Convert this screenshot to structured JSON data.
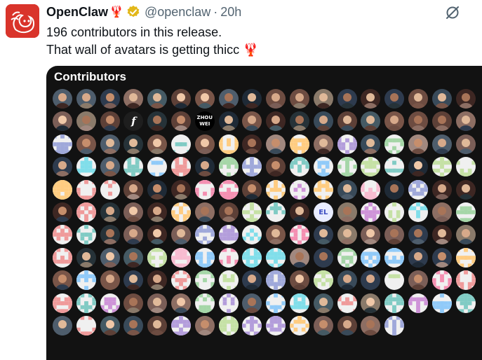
{
  "tweet": {
    "author_name": "OpenClaw",
    "author_emoji": "🦞",
    "handle": "@openclaw",
    "separator": "·",
    "time": "20h",
    "line1": "196 contributors in this release.",
    "line2": "That wall of avatars is getting thicc",
    "line2_emoji": "🦞"
  },
  "media": {
    "title": "Contributors",
    "avatar_texts": [
      "ZHOU WEI",
      "EL",
      "f"
    ]
  },
  "colors": {
    "brand_red": "#d9342b",
    "verified_gold": "#e2b719",
    "media_bg": "#121212",
    "muted_text": "#536471"
  },
  "icons": [
    "verified-badge-icon",
    "grok-icon",
    "lobster-icon"
  ]
}
